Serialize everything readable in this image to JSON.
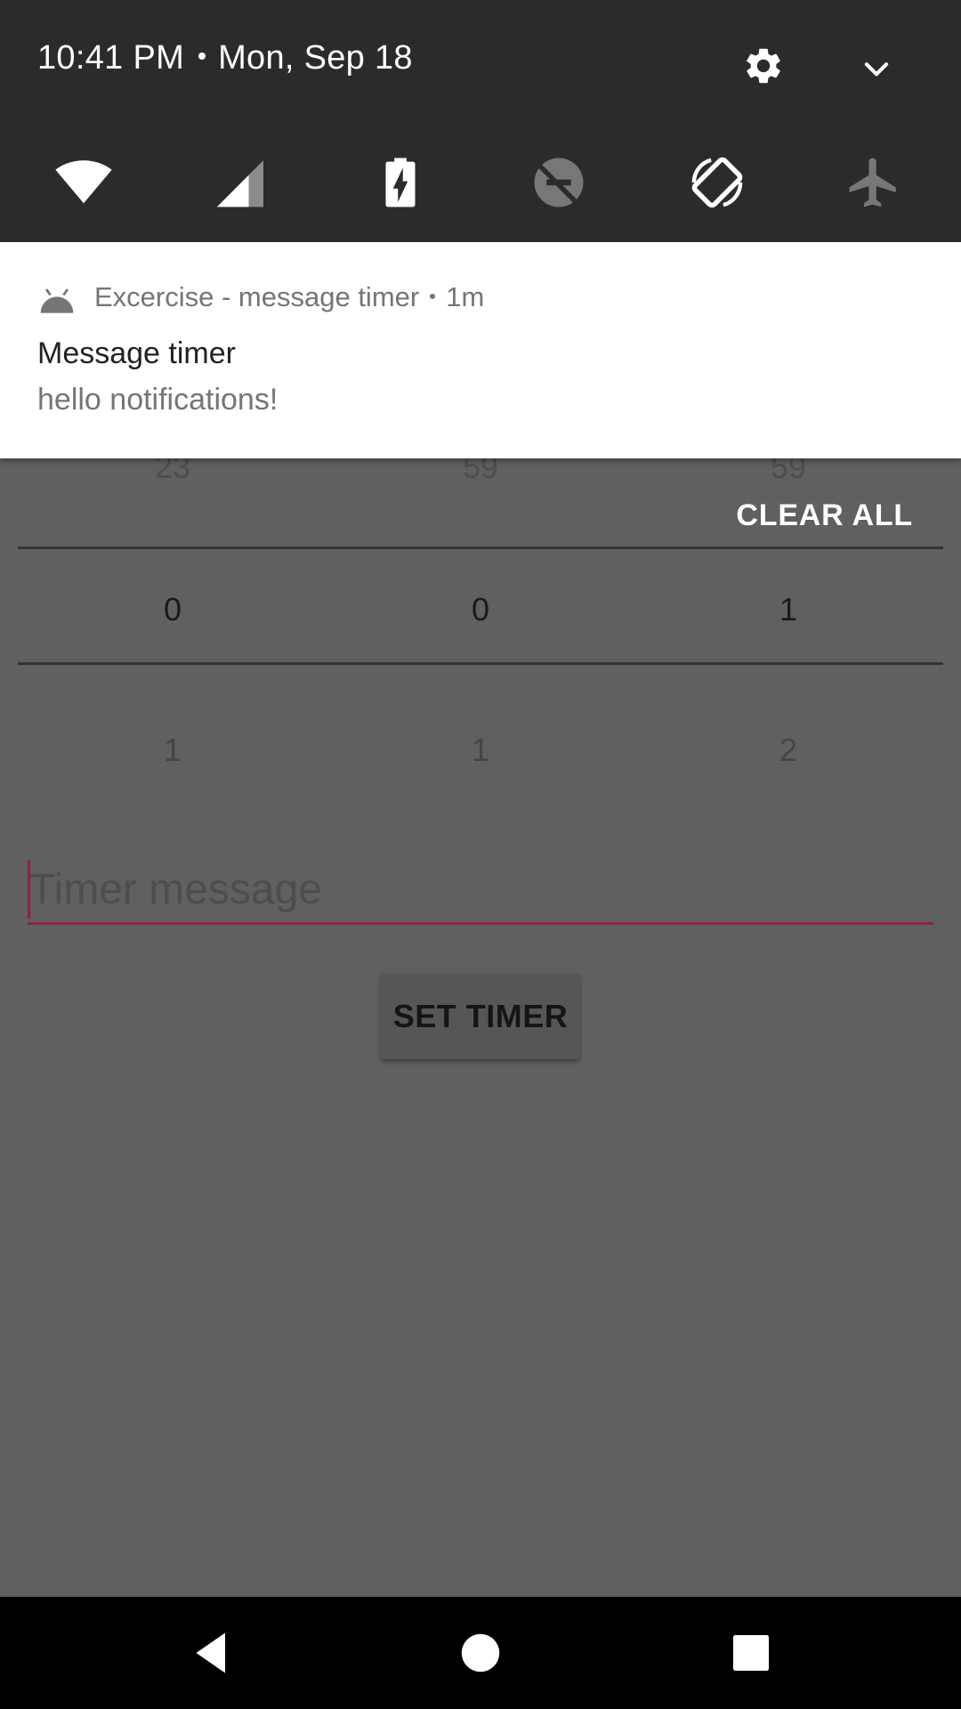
{
  "status": {
    "time": "10:41 PM",
    "date": "Mon, Sep 18"
  },
  "quick_settings": {
    "icons": [
      "gear-icon",
      "chevron-down-icon",
      "wifi-icon",
      "cell-signal-icon",
      "battery-charging-icon",
      "dnd-off-icon",
      "auto-rotate-icon",
      "airplane-mode-icon"
    ]
  },
  "notification": {
    "app_name": "Excercise - message timer",
    "age": "1m",
    "title": "Message timer",
    "text": "hello notifications!",
    "clear_all": "CLEAR ALL"
  },
  "picker": {
    "above": [
      "23",
      "59",
      "59"
    ],
    "selected": [
      "0",
      "0",
      "1"
    ],
    "below": [
      "1",
      "1",
      "2"
    ]
  },
  "input": {
    "placeholder": "Timer message",
    "value": ""
  },
  "button": {
    "label": "SET TIMER"
  },
  "colors": {
    "accent": "#8f2045",
    "scrim": "#606060",
    "notification_bg": "#ffffff",
    "quick_settings_bg": "#2b2b2b"
  },
  "navbar": {
    "icons": [
      "back-icon",
      "home-icon",
      "recents-icon"
    ]
  }
}
